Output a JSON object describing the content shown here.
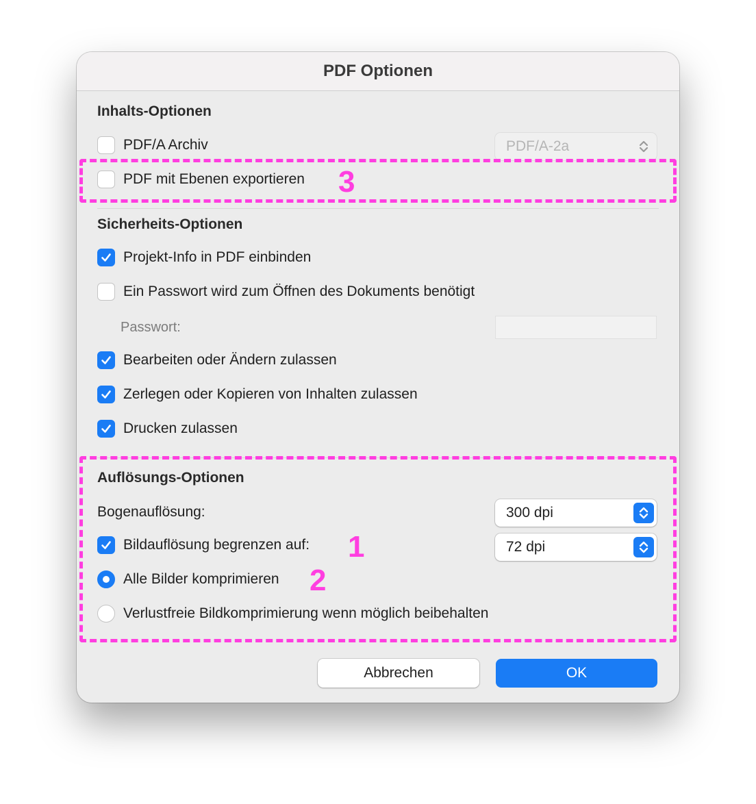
{
  "window": {
    "title": "PDF Optionen"
  },
  "content_options": {
    "title": "Inhalts-Optionen",
    "pdfa_label": "PDF/A Archiv",
    "pdfa_checked": false,
    "pdfa_select": "PDF/A-2a",
    "layers_label": "PDF mit Ebenen exportieren",
    "layers_checked": false
  },
  "security_options": {
    "title": "Sicherheits-Optionen",
    "project_info_label": "Projekt-Info in PDF einbinden",
    "project_info_checked": true,
    "password_required_label": "Ein Passwort wird zum Öffnen des Dokuments benötigt",
    "password_required_checked": false,
    "password_label": "Passwort:",
    "password_value": "",
    "edit_label": "Bearbeiten oder Ändern zulassen",
    "edit_checked": true,
    "copy_label": "Zerlegen oder Kopieren von Inhalten zulassen",
    "copy_checked": true,
    "print_label": "Drucken zulassen",
    "print_checked": true
  },
  "resolution_options": {
    "title": "Auflösungs-Optionen",
    "sheet_resolution_label": "Bogenauflösung:",
    "sheet_resolution_value": "300 dpi",
    "limit_label": "Bildauflösung begrenzen auf:",
    "limit_checked": true,
    "limit_value": "72 dpi",
    "compress_all_label": "Alle Bilder komprimieren",
    "compress_all_selected": true,
    "lossless_label": "Verlustfreie Bildkomprimierung wenn möglich beibehalten",
    "lossless_selected": false
  },
  "buttons": {
    "cancel": "Abbrechen",
    "ok": "OK"
  },
  "annotations": {
    "one": "1",
    "two": "2",
    "three": "3"
  },
  "colors": {
    "accent": "#1a7cf5",
    "annotation": "#ff3ee0"
  }
}
